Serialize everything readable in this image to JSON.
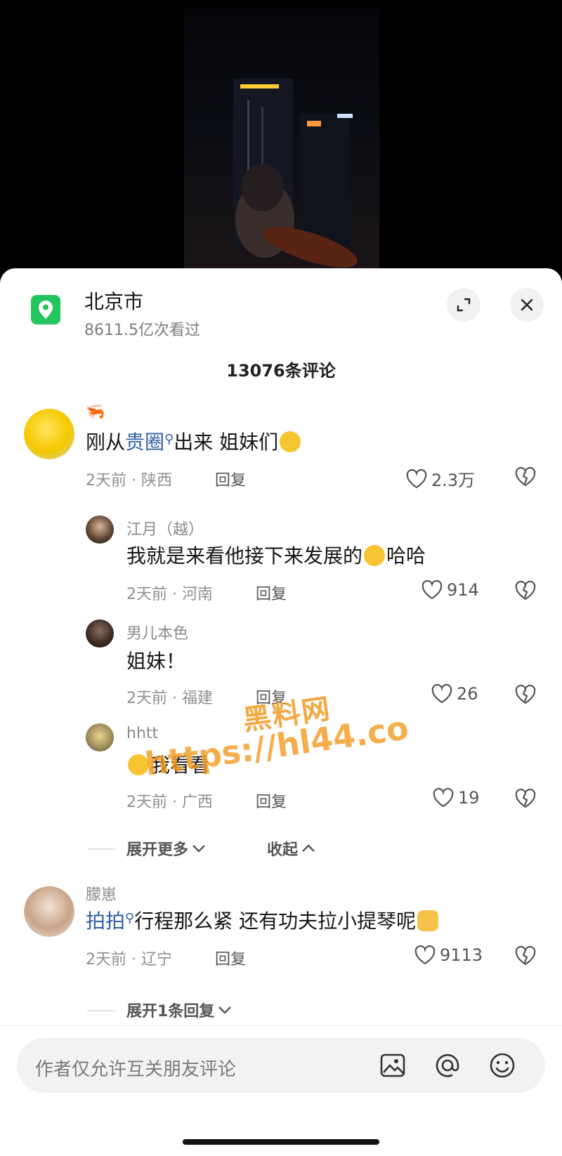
{
  "location": {
    "title": "北京市",
    "views": "8611.5亿次看过"
  },
  "comments_count": "13076条评论",
  "comments": [
    {
      "user": "🦐",
      "text_parts": [
        "刚从",
        "贵圈",
        "出来 姐妹们"
      ],
      "meta": "2天前 · 陕西",
      "reply": "回复",
      "likes": "2.3万"
    },
    {
      "user": "江月（越）",
      "text_parts": [
        "我就是来看他接下来发展的",
        "哈哈"
      ],
      "meta": "2天前 · 河南",
      "reply": "回复",
      "likes": "914"
    },
    {
      "user": "男儿本色",
      "text": "姐妹！",
      "meta": "2天前 · 福建",
      "reply": "回复",
      "likes": "26"
    },
    {
      "user": "hhtt",
      "text": "我看看",
      "meta": "2天前 · 广西",
      "reply": "回复",
      "likes": "19"
    },
    {
      "user": "朦崽",
      "text_parts": [
        "拍拍",
        "行程那么紧 还有功夫拉小提琴呢"
      ],
      "meta": "2天前 · 辽宁",
      "reply": "回复",
      "likes": "9113"
    }
  ],
  "expand_more": "展开更多",
  "collapse": "收起",
  "expand_replies": "展开1条回复",
  "input": {
    "placeholder": "作者仅允许互关朋友评论"
  },
  "watermark": {
    "line1": "黑料网",
    "line2": "https://hl44.co"
  },
  "icons": {
    "location": "location-pin-icon",
    "expand": "expand-icon",
    "close": "close-icon",
    "like": "heart-icon",
    "dislike": "broken-heart-icon",
    "image": "image-icon",
    "mention": "at-icon",
    "emoji": "emoji-icon"
  },
  "colors": {
    "accent_green": "#22c55e",
    "tag_blue": "#2f5fa8",
    "watermark": "#f39a1f"
  }
}
